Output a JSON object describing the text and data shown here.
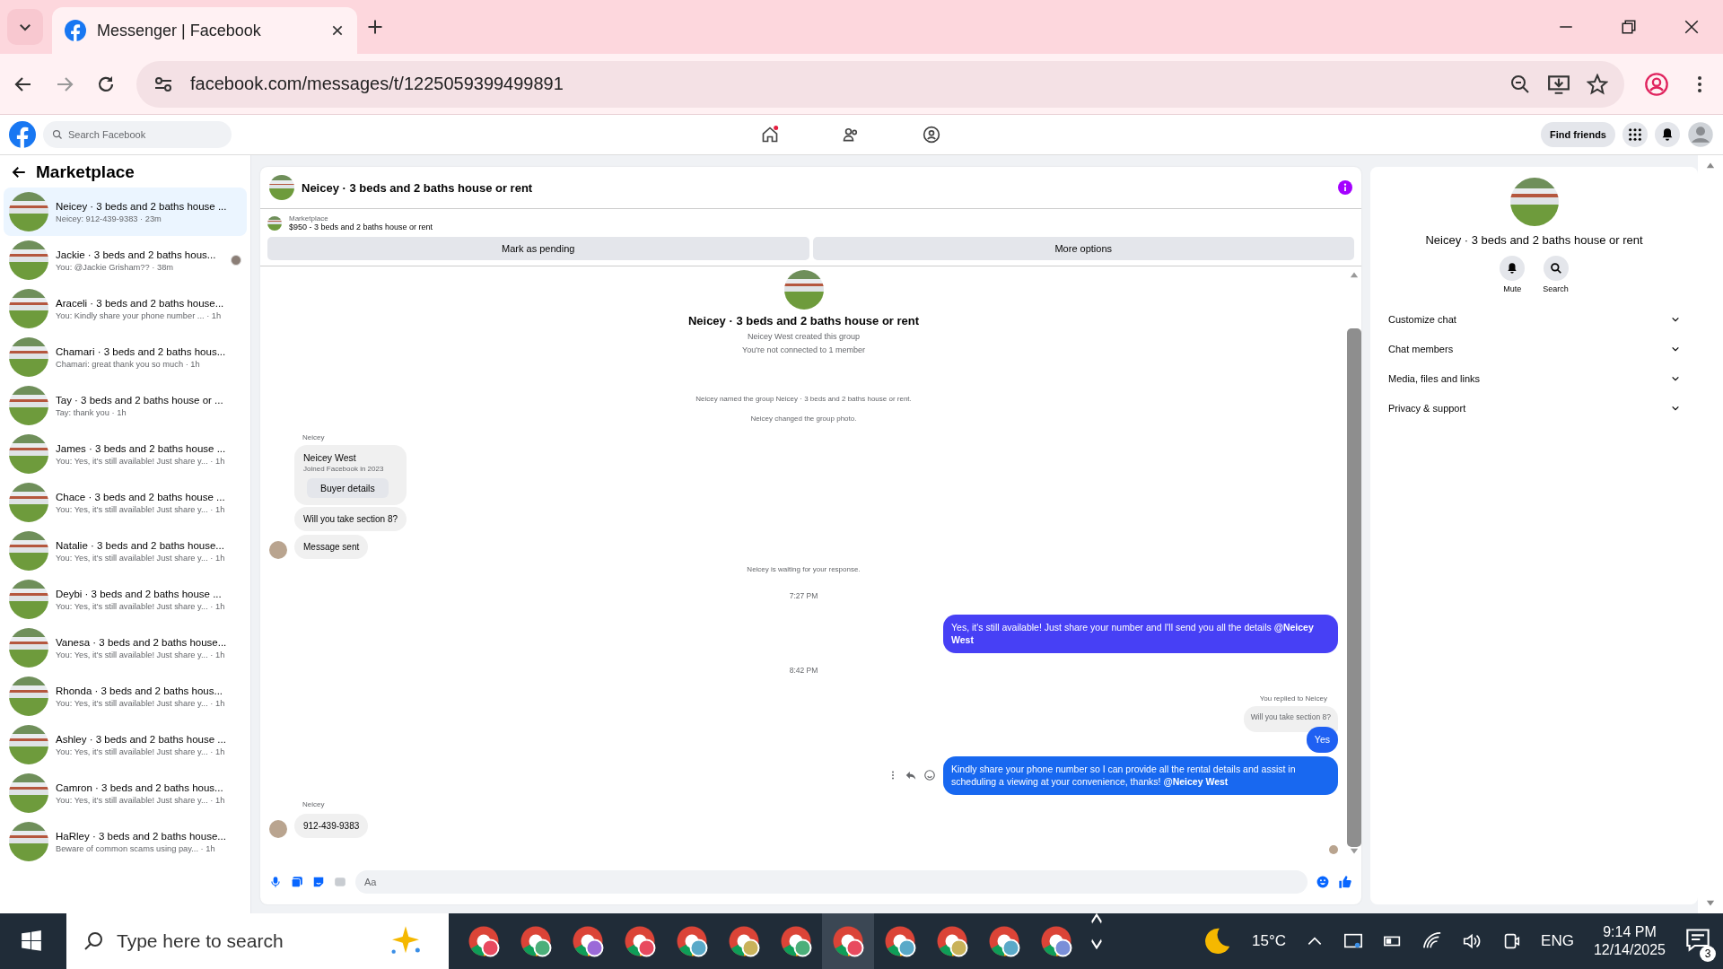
{
  "browser": {
    "tab_title": "Messenger | Facebook",
    "url": "facebook.com/messages/t/1225059399499891"
  },
  "facebook_nav": {
    "search_placeholder": "Search Facebook",
    "home_notification": true,
    "find_friends": "Find friends"
  },
  "sidebar": {
    "title": "Marketplace",
    "conversations": [
      {
        "name": "Neicey · 3 beds and 2 baths house ...",
        "preview": "Neicey: 912-439-9383 · 23m",
        "selected": true,
        "seen": false
      },
      {
        "name": "Jackie · 3 beds and 2 baths hous...",
        "preview": "You: @Jackie Grisham?? · 38m",
        "selected": false,
        "seen": true
      },
      {
        "name": "Araceli · 3 beds and 2 baths house...",
        "preview": "You: Kindly share your phone number ... · 1h",
        "selected": false,
        "seen": false
      },
      {
        "name": "Chamari · 3 beds and 2 baths hous...",
        "preview": "Chamari: great thank you so much · 1h",
        "selected": false,
        "seen": false
      },
      {
        "name": "Tay · 3 beds and 2 baths house or ...",
        "preview": "Tay: thank you · 1h",
        "selected": false,
        "seen": false
      },
      {
        "name": "James · 3 beds and 2 baths house ...",
        "preview": "You: Yes, it's still available! Just share y... · 1h",
        "selected": false,
        "seen": false
      },
      {
        "name": "Chace · 3 beds and 2 baths house ...",
        "preview": "You: Yes, it's still available! Just share y... · 1h",
        "selected": false,
        "seen": false
      },
      {
        "name": "Natalie · 3 beds and 2 baths house...",
        "preview": "You: Yes, it's still available! Just share y... · 1h",
        "selected": false,
        "seen": false
      },
      {
        "name": "Deybi · 3 beds and 2 baths house ...",
        "preview": "You: Yes, it's still available! Just share y... · 1h",
        "selected": false,
        "seen": false
      },
      {
        "name": "Vanesa · 3 beds and 2 baths house...",
        "preview": "You: Yes, it's still available! Just share y... · 1h",
        "selected": false,
        "seen": false
      },
      {
        "name": "Rhonda · 3 beds and 2 baths hous...",
        "preview": "You: Yes, it's still available! Just share y... · 1h",
        "selected": false,
        "seen": false
      },
      {
        "name": "Ashley · 3 beds and 2 baths house ...",
        "preview": "You: Yes, it's still available! Just share y... · 1h",
        "selected": false,
        "seen": false
      },
      {
        "name": "Camron · 3 beds and 2 baths hous...",
        "preview": "You: Yes, it's still available! Just share y... · 1h",
        "selected": false,
        "seen": false
      },
      {
        "name": "HaRley · 3 beds and 2 baths house...",
        "preview": "Beware of common scams using pay...  · 1h",
        "selected": false,
        "seen": false
      }
    ]
  },
  "chat": {
    "title": "Neicey · 3 beds and 2 baths house or rent",
    "listing": {
      "label": "Marketplace",
      "text": "$950 - 3 beds and 2 baths house or rent"
    },
    "actions": [
      "Mark as pending",
      "More options"
    ],
    "intro": {
      "title": "Neicey · 3 beds and 2 baths house or rent",
      "lines": [
        "Neicey West created this group",
        "You're not connected to 1 member"
      ]
    },
    "messages": [
      {
        "kind": "event",
        "text": "Neicey named the group Neicey · 3 beds and 2 baths house or rent."
      },
      {
        "kind": "event",
        "text": "Neicey changed the group photo."
      },
      {
        "kind": "sender",
        "text": "Neicey"
      },
      {
        "kind": "profile_card",
        "name": "Neicey West",
        "meta": "Joined Facebook in 2023",
        "button": "Buyer details"
      },
      {
        "kind": "incoming",
        "text": "Will you take section 8?",
        "avatar": false
      },
      {
        "kind": "incoming",
        "text": "Message sent",
        "avatar": true
      },
      {
        "kind": "event",
        "text": "Neicey is waiting for your response."
      },
      {
        "kind": "time",
        "text": "7:27 PM"
      },
      {
        "kind": "outgoing",
        "text": "Yes, it's still available! Just share your number and I'll send you all the details **@Neicey West**",
        "color": "#4740f5",
        "actions": false
      },
      {
        "kind": "time",
        "text": "8:42 PM"
      },
      {
        "kind": "reply",
        "label": "You replied to Neicey",
        "quoted": "Will you take section 8?"
      },
      {
        "kind": "outgoing",
        "text": "Yes",
        "color": "#1f60f2",
        "actions": false
      },
      {
        "kind": "outgoing",
        "text": "Kindly share your phone number so I can provide all the rental details and assist in scheduling a viewing at your convenience, thanks! **@Neicey West**",
        "color": "#1868f0",
        "actions": true
      },
      {
        "kind": "sender",
        "text": "Neicey"
      },
      {
        "kind": "incoming",
        "text": "912-439-9383",
        "avatar": true
      }
    ],
    "seen": true,
    "composer": {
      "placeholder": "Aa"
    }
  },
  "info_panel": {
    "title": "Neicey · 3 beds and 2 baths house or rent",
    "actions": [
      {
        "kind": "mute",
        "label": "Mute"
      },
      {
        "kind": "search",
        "label": "Search"
      }
    ],
    "sections": [
      {
        "label": "Customize chat",
        "expanded": false
      },
      {
        "label": "Chat members",
        "expanded": false
      },
      {
        "label": "Media, files and links",
        "expanded": false
      },
      {
        "label": "Privacy & support",
        "expanded": false
      }
    ]
  },
  "taskbar": {
    "search_placeholder": "Type here to search",
    "apps": [
      {
        "selected": false,
        "color": "#e84a5f"
      },
      {
        "selected": false,
        "color": "#4caf7a"
      },
      {
        "selected": false,
        "color": "#9b6ad8"
      },
      {
        "selected": false,
        "color": "#e84a5f"
      },
      {
        "selected": false,
        "color": "#5aa9c8"
      },
      {
        "selected": false,
        "color": "#c9b25a"
      },
      {
        "selected": false,
        "color": "#4caf7a"
      },
      {
        "selected": true,
        "color": "#e84a5f"
      },
      {
        "selected": false,
        "color": "#5aa9c8"
      },
      {
        "selected": false,
        "color": "#c9b25a"
      },
      {
        "selected": false,
        "color": "#5aa9c8"
      },
      {
        "selected": false,
        "color": "#7a8fd8"
      }
    ],
    "temperature": "15°C",
    "language": "ENG",
    "time": "9:14 PM",
    "date": "12/14/2025",
    "notifications": "3"
  }
}
